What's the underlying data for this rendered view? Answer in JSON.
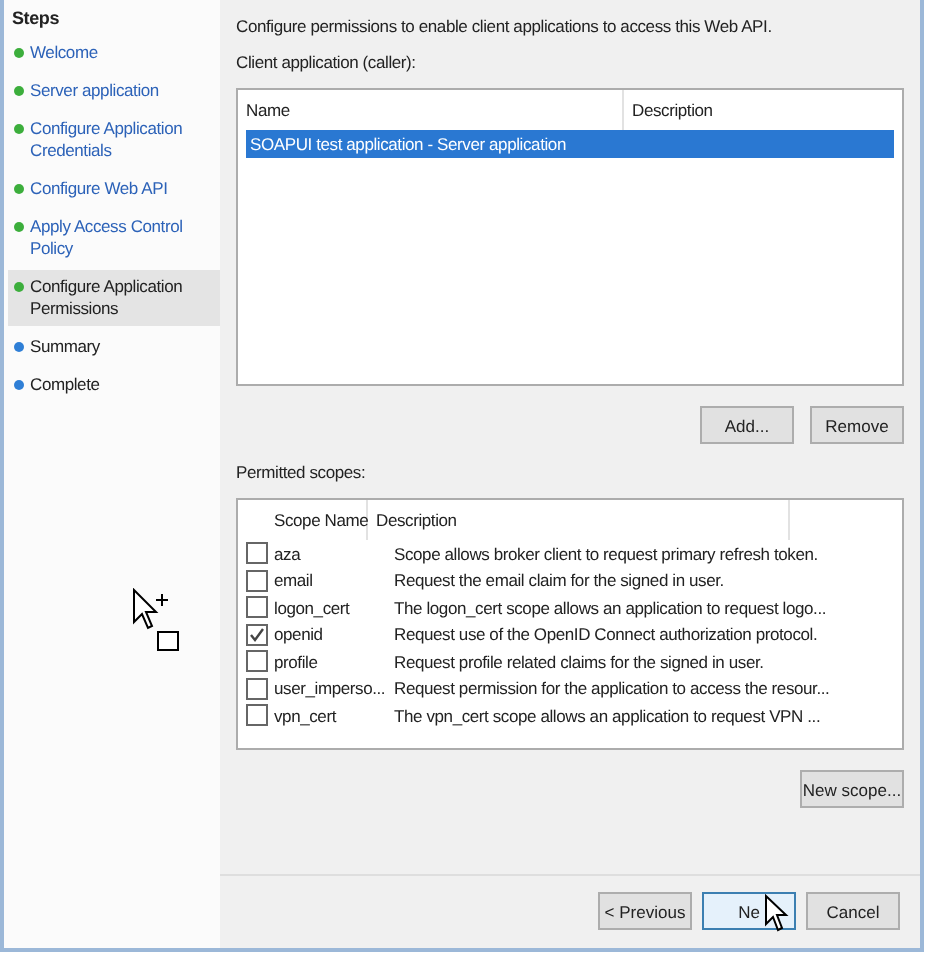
{
  "sidebar": {
    "title": "Steps",
    "items": [
      {
        "label": "Welcome",
        "color": "#3cae3c",
        "selected": false,
        "link": true
      },
      {
        "label": "Server application",
        "color": "#3cae3c",
        "selected": false,
        "link": true
      },
      {
        "label": "Configure Application Credentials",
        "color": "#3cae3c",
        "selected": false,
        "link": true
      },
      {
        "label": "Configure Web API",
        "color": "#3cae3c",
        "selected": false,
        "link": true
      },
      {
        "label": "Apply Access Control Policy",
        "color": "#3cae3c",
        "selected": false,
        "link": true
      },
      {
        "label": "Configure Application Permissions",
        "color": "#3cae3c",
        "selected": true,
        "link": false
      },
      {
        "label": "Summary",
        "color": "#2f7fd6",
        "selected": false,
        "link": false
      },
      {
        "label": "Complete",
        "color": "#2f7fd6",
        "selected": false,
        "link": false
      }
    ]
  },
  "intro": "Configure permissions to enable client applications to access this Web API.",
  "clients": {
    "label": "Client application (caller):",
    "columns": [
      "Name",
      "Description"
    ],
    "rows": [
      {
        "name": "SOAPUI test application - Server application",
        "selected": true
      }
    ],
    "buttons": [
      "Add...",
      "Remove"
    ]
  },
  "scopes": {
    "label": "Permitted scopes:",
    "columns": [
      "Scope Name",
      "Description"
    ],
    "rows": [
      {
        "name": "aza",
        "description": "Scope allows broker client to request primary refresh token.",
        "checked": false
      },
      {
        "name": "email",
        "description": "Request the email claim for the signed in user.",
        "checked": false
      },
      {
        "name": "logon_cert",
        "description": "The logon_cert scope allows an application to request logo...",
        "checked": false
      },
      {
        "name": "openid",
        "description": "Request use of the OpenID Connect authorization protocol.",
        "checked": true
      },
      {
        "name": "profile",
        "description": "Request profile related claims for the signed in user.",
        "checked": false
      },
      {
        "name": "user_imperso...",
        "description": "Request permission for the application to access the resour...",
        "checked": false
      },
      {
        "name": "vpn_cert",
        "description": "The vpn_cert scope allows an application to request VPN ...",
        "checked": false
      }
    ],
    "button": "New scope..."
  },
  "footer": {
    "buttons": [
      {
        "label": "< Previous",
        "kind": "normal"
      },
      {
        "label": "Ne",
        "kind": "default"
      },
      {
        "label": "Cancel",
        "kind": "normal"
      }
    ]
  }
}
